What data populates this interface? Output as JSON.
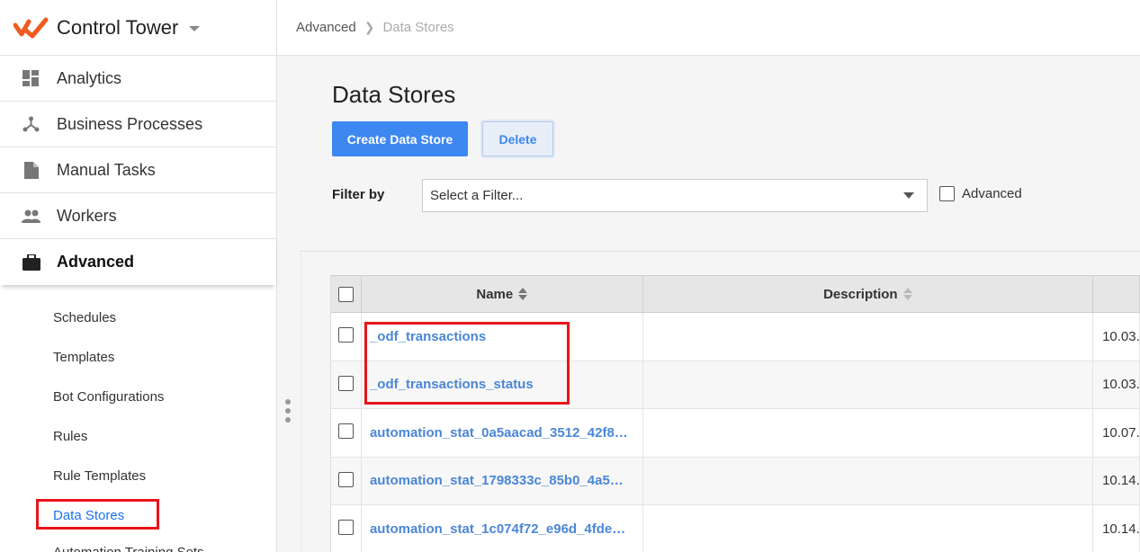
{
  "app": {
    "title": "Control Tower"
  },
  "sidebar": {
    "nav": [
      {
        "label": "Analytics",
        "icon": "dashboard-icon"
      },
      {
        "label": "Business Processes",
        "icon": "process-icon"
      },
      {
        "label": "Manual Tasks",
        "icon": "document-icon"
      },
      {
        "label": "Workers",
        "icon": "people-icon"
      },
      {
        "label": "Advanced",
        "icon": "briefcase-icon"
      }
    ],
    "subnav": [
      {
        "label": "Schedules"
      },
      {
        "label": "Templates"
      },
      {
        "label": "Bot Configurations"
      },
      {
        "label": "Rules"
      },
      {
        "label": "Rule Templates"
      },
      {
        "label": "Data Stores"
      },
      {
        "label": "Automation Training Sets"
      }
    ]
  },
  "breadcrumb": {
    "parent": "Advanced",
    "current": "Data Stores"
  },
  "page": {
    "title": "Data Stores",
    "create_label": "Create Data Store",
    "delete_label": "Delete",
    "filter_label": "Filter by",
    "filter_placeholder": "Select a Filter...",
    "advanced_label": "Advanced"
  },
  "table": {
    "columns": {
      "name": "Name",
      "description": "Description"
    },
    "rows": [
      {
        "name": "_odf_transactions",
        "description": "",
        "date": "10.03."
      },
      {
        "name": "_odf_transactions_status",
        "description": "",
        "date": "10.03."
      },
      {
        "name": "automation_stat_0a5aacad_3512_42f8…",
        "description": "",
        "date": "10.07."
      },
      {
        "name": "automation_stat_1798333c_85b0_4a5…",
        "description": "",
        "date": "10.14."
      },
      {
        "name": "automation_stat_1c074f72_e96d_4fde…",
        "description": "",
        "date": "10.14."
      }
    ]
  },
  "colors": {
    "accent": "#3c87f0",
    "link": "#4a86d8",
    "highlight": "#e8141b",
    "brand": "#f05a1e"
  }
}
